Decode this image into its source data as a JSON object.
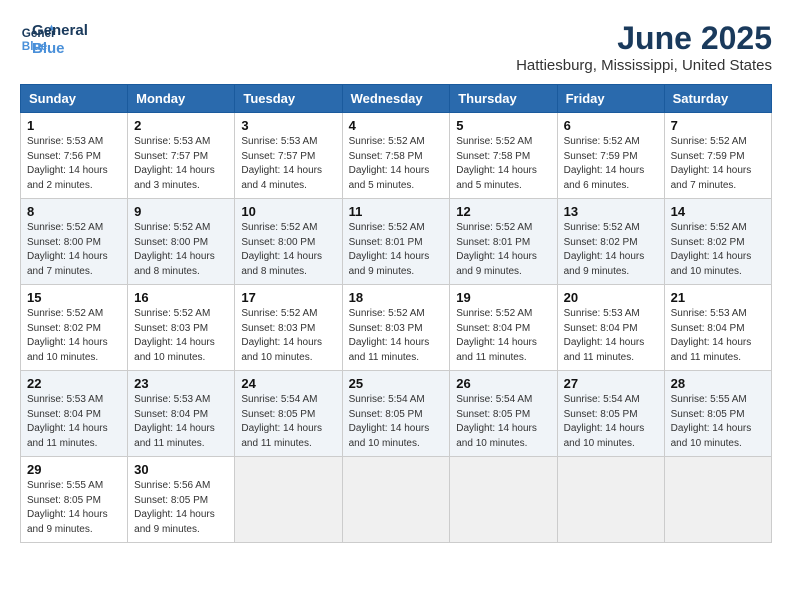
{
  "logo": {
    "line1": "General",
    "line2": "Blue"
  },
  "title": "June 2025",
  "location": "Hattiesburg, Mississippi, United States",
  "weekdays": [
    "Sunday",
    "Monday",
    "Tuesday",
    "Wednesday",
    "Thursday",
    "Friday",
    "Saturday"
  ],
  "weeks": [
    [
      {
        "day": "1",
        "info": "Sunrise: 5:53 AM\nSunset: 7:56 PM\nDaylight: 14 hours\nand 2 minutes."
      },
      {
        "day": "2",
        "info": "Sunrise: 5:53 AM\nSunset: 7:57 PM\nDaylight: 14 hours\nand 3 minutes."
      },
      {
        "day": "3",
        "info": "Sunrise: 5:53 AM\nSunset: 7:57 PM\nDaylight: 14 hours\nand 4 minutes."
      },
      {
        "day": "4",
        "info": "Sunrise: 5:52 AM\nSunset: 7:58 PM\nDaylight: 14 hours\nand 5 minutes."
      },
      {
        "day": "5",
        "info": "Sunrise: 5:52 AM\nSunset: 7:58 PM\nDaylight: 14 hours\nand 5 minutes."
      },
      {
        "day": "6",
        "info": "Sunrise: 5:52 AM\nSunset: 7:59 PM\nDaylight: 14 hours\nand 6 minutes."
      },
      {
        "day": "7",
        "info": "Sunrise: 5:52 AM\nSunset: 7:59 PM\nDaylight: 14 hours\nand 7 minutes."
      }
    ],
    [
      {
        "day": "8",
        "info": "Sunrise: 5:52 AM\nSunset: 8:00 PM\nDaylight: 14 hours\nand 7 minutes."
      },
      {
        "day": "9",
        "info": "Sunrise: 5:52 AM\nSunset: 8:00 PM\nDaylight: 14 hours\nand 8 minutes."
      },
      {
        "day": "10",
        "info": "Sunrise: 5:52 AM\nSunset: 8:00 PM\nDaylight: 14 hours\nand 8 minutes."
      },
      {
        "day": "11",
        "info": "Sunrise: 5:52 AM\nSunset: 8:01 PM\nDaylight: 14 hours\nand 9 minutes."
      },
      {
        "day": "12",
        "info": "Sunrise: 5:52 AM\nSunset: 8:01 PM\nDaylight: 14 hours\nand 9 minutes."
      },
      {
        "day": "13",
        "info": "Sunrise: 5:52 AM\nSunset: 8:02 PM\nDaylight: 14 hours\nand 9 minutes."
      },
      {
        "day": "14",
        "info": "Sunrise: 5:52 AM\nSunset: 8:02 PM\nDaylight: 14 hours\nand 10 minutes."
      }
    ],
    [
      {
        "day": "15",
        "info": "Sunrise: 5:52 AM\nSunset: 8:02 PM\nDaylight: 14 hours\nand 10 minutes."
      },
      {
        "day": "16",
        "info": "Sunrise: 5:52 AM\nSunset: 8:03 PM\nDaylight: 14 hours\nand 10 minutes."
      },
      {
        "day": "17",
        "info": "Sunrise: 5:52 AM\nSunset: 8:03 PM\nDaylight: 14 hours\nand 10 minutes."
      },
      {
        "day": "18",
        "info": "Sunrise: 5:52 AM\nSunset: 8:03 PM\nDaylight: 14 hours\nand 11 minutes."
      },
      {
        "day": "19",
        "info": "Sunrise: 5:52 AM\nSunset: 8:04 PM\nDaylight: 14 hours\nand 11 minutes."
      },
      {
        "day": "20",
        "info": "Sunrise: 5:53 AM\nSunset: 8:04 PM\nDaylight: 14 hours\nand 11 minutes."
      },
      {
        "day": "21",
        "info": "Sunrise: 5:53 AM\nSunset: 8:04 PM\nDaylight: 14 hours\nand 11 minutes."
      }
    ],
    [
      {
        "day": "22",
        "info": "Sunrise: 5:53 AM\nSunset: 8:04 PM\nDaylight: 14 hours\nand 11 minutes."
      },
      {
        "day": "23",
        "info": "Sunrise: 5:53 AM\nSunset: 8:04 PM\nDaylight: 14 hours\nand 11 minutes."
      },
      {
        "day": "24",
        "info": "Sunrise: 5:54 AM\nSunset: 8:05 PM\nDaylight: 14 hours\nand 11 minutes."
      },
      {
        "day": "25",
        "info": "Sunrise: 5:54 AM\nSunset: 8:05 PM\nDaylight: 14 hours\nand 10 minutes."
      },
      {
        "day": "26",
        "info": "Sunrise: 5:54 AM\nSunset: 8:05 PM\nDaylight: 14 hours\nand 10 minutes."
      },
      {
        "day": "27",
        "info": "Sunrise: 5:54 AM\nSunset: 8:05 PM\nDaylight: 14 hours\nand 10 minutes."
      },
      {
        "day": "28",
        "info": "Sunrise: 5:55 AM\nSunset: 8:05 PM\nDaylight: 14 hours\nand 10 minutes."
      }
    ],
    [
      {
        "day": "29",
        "info": "Sunrise: 5:55 AM\nSunset: 8:05 PM\nDaylight: 14 hours\nand 9 minutes."
      },
      {
        "day": "30",
        "info": "Sunrise: 5:56 AM\nSunset: 8:05 PM\nDaylight: 14 hours\nand 9 minutes."
      },
      {
        "day": "",
        "info": ""
      },
      {
        "day": "",
        "info": ""
      },
      {
        "day": "",
        "info": ""
      },
      {
        "day": "",
        "info": ""
      },
      {
        "day": "",
        "info": ""
      }
    ]
  ]
}
